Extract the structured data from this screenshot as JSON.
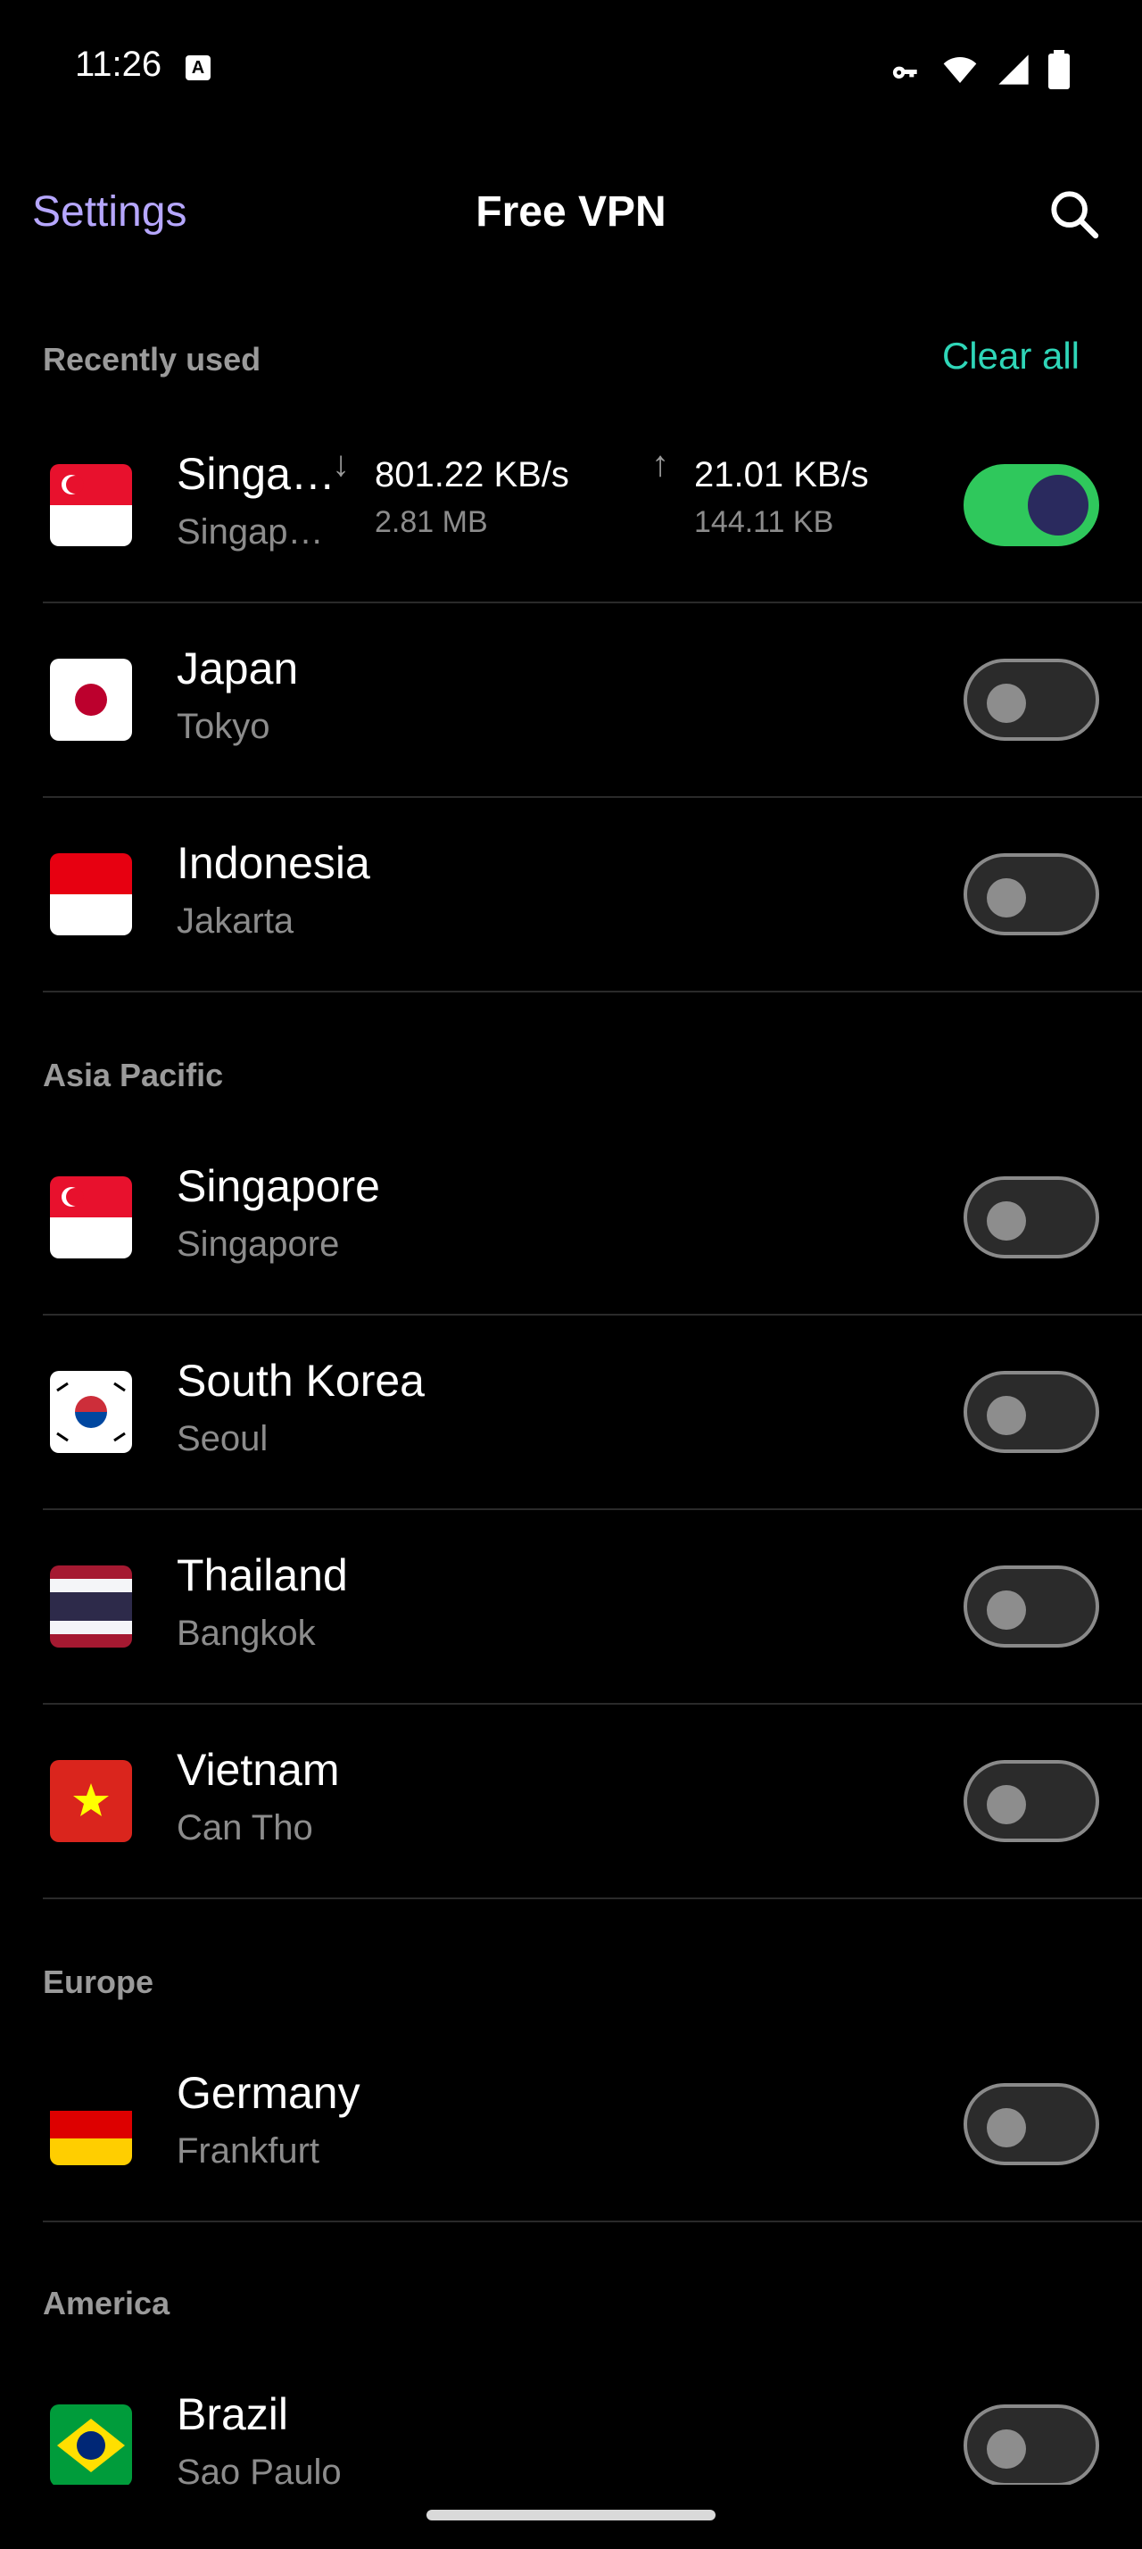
{
  "status_bar": {
    "time": "11:26",
    "icons": [
      "accessibility-icon",
      "vpn-key-icon",
      "wifi-icon",
      "signal-icon",
      "battery-icon"
    ]
  },
  "app_bar": {
    "left_link": "Settings",
    "title": "Free VPN",
    "right_icon": "search-icon"
  },
  "recent": {
    "header": "Recently used",
    "action": "Clear all",
    "items": [
      {
        "country": "Singa…",
        "city": "Singap…",
        "flag": "sg",
        "active": true,
        "down_rate": "801.22 KB/s",
        "down_total": "2.81 MB",
        "up_rate": "21.01 KB/s",
        "up_total": "144.11 KB"
      },
      {
        "country": "Japan",
        "city": "Tokyo",
        "flag": "jp",
        "active": false
      },
      {
        "country": "Indonesia",
        "city": "Jakarta",
        "flag": "id",
        "active": false
      }
    ]
  },
  "sections": [
    {
      "header": "Asia Pacific",
      "items": [
        {
          "country": "Singapore",
          "city": "Singapore",
          "flag": "sg",
          "active": false
        },
        {
          "country": "South Korea",
          "city": "Seoul",
          "flag": "kr",
          "active": false
        },
        {
          "country": "Thailand",
          "city": "Bangkok",
          "flag": "th",
          "active": false
        },
        {
          "country": "Vietnam",
          "city": "Can Tho",
          "flag": "vn",
          "active": false
        }
      ]
    },
    {
      "header": "Europe",
      "items": [
        {
          "country": "Germany",
          "city": "Frankfurt",
          "flag": "de",
          "active": false
        }
      ]
    },
    {
      "header": "America",
      "items": [
        {
          "country": "Brazil",
          "city": "Sao Paulo",
          "flag": "br",
          "active": false
        }
      ]
    }
  ],
  "colors": {
    "accent_link": "#b6a7ff",
    "clear_all": "#2fd6b8",
    "toggle_on": "#2fc85c"
  }
}
